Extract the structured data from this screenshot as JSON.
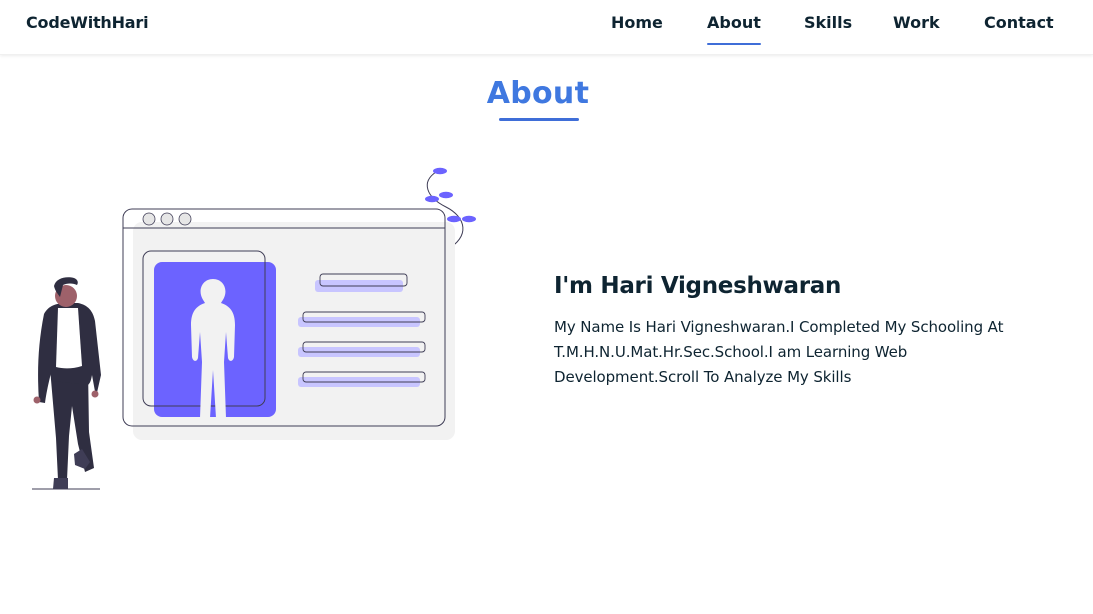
{
  "header": {
    "logo": "CodeWithHari",
    "nav": [
      {
        "label": "Home",
        "active": false
      },
      {
        "label": "About",
        "active": true
      },
      {
        "label": "Skills",
        "active": false
      },
      {
        "label": "Work",
        "active": false
      },
      {
        "label": "Contact",
        "active": false
      }
    ]
  },
  "about": {
    "section_title": "About",
    "heading": "I'm Hari Vigneshwaran",
    "description": "My Name Is Hari Vigneshwaran.I Completed My Schooling At T.M.H.N.U.Mat.Hr.Sec.School.I am Learning Web Development.Scroll To Analyze My Skills",
    "illustration_icon": "person-profile-illustration"
  },
  "colors": {
    "accent": "#3f78e0",
    "underline": "#3f6ed8",
    "illustration_purple": "#6c63ff",
    "text": "#0e2431"
  }
}
